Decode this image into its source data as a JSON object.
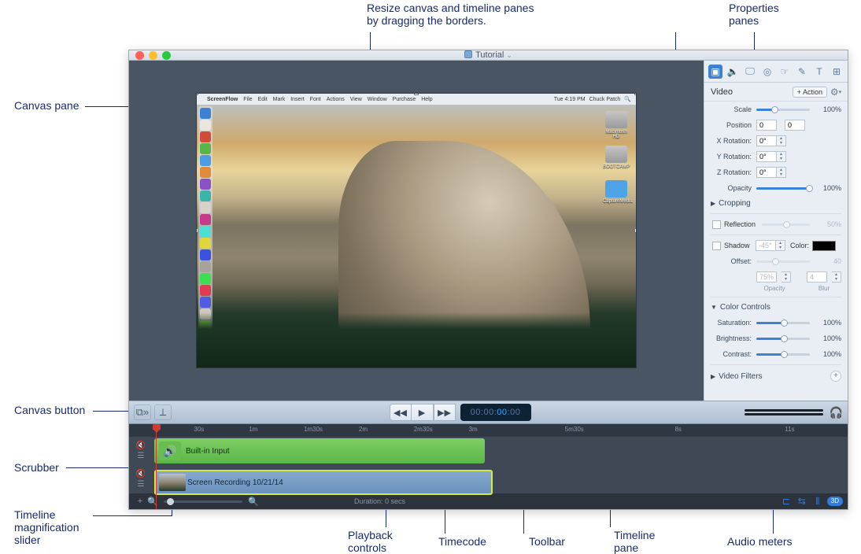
{
  "callouts": {
    "resize": "Resize canvas and timeline panes\nby dragging the borders.",
    "props": "Properties\npanes",
    "canvas_pane": "Canvas pane",
    "canvas_button": "Canvas button",
    "scrubber": "Scrubber",
    "mag": "Timeline\nmagnification\nslider",
    "playback": "Playback\ncontrols",
    "timecode": "Timecode",
    "toolbar": "Toolbar",
    "timeline_pane": "Timeline\npane",
    "audio_meters": "Audio meters"
  },
  "window": {
    "title": "Tutorial"
  },
  "canvas": {
    "menubar": {
      "app": "ScreenFlow",
      "items": [
        "File",
        "Edit",
        "Mark",
        "Insert",
        "Font",
        "Actions",
        "View",
        "Window",
        "Purchase",
        "Help"
      ],
      "clock": "Tue 4:19 PM",
      "user": "Chuck Patch"
    },
    "desktop_icons": [
      "Macintosh HD",
      "BOOTCAMP",
      "CaptureMedia"
    ]
  },
  "props": {
    "title": "Video",
    "action_btn": "+ Action",
    "scale": {
      "label": "Scale",
      "value": "100%",
      "pct": 100
    },
    "position": {
      "label": "Position",
      "x": "0",
      "y": "0"
    },
    "xrot": {
      "label": "X Rotation:",
      "value": "0°"
    },
    "yrot": {
      "label": "Y Rotation:",
      "value": "0°"
    },
    "zrot": {
      "label": "Z Rotation:",
      "value": "0°"
    },
    "opacity": {
      "label": "Opacity",
      "value": "100%",
      "pct": 100
    },
    "cropping": "Cropping",
    "reflection": {
      "label": "Reflection",
      "value": "50%"
    },
    "shadow": {
      "label": "Shadow",
      "angle": "-45°",
      "color_label": "Color:"
    },
    "offset": {
      "label": "Offset:",
      "value": "40"
    },
    "shadow_opacity": "75%",
    "shadow_blur": "4",
    "opacity_sub": "Opacity",
    "blur_sub": "Blur",
    "color_controls": "Color Controls",
    "saturation": {
      "label": "Saturation:",
      "value": "100%",
      "pct": 50
    },
    "brightness": {
      "label": "Brightness:",
      "value": "100%",
      "pct": 50
    },
    "contrast": {
      "label": "Contrast:",
      "value": "100%",
      "pct": 50
    },
    "video_filters": "Video Filters"
  },
  "toolbar": {
    "timecode_lead": "00:00:",
    "timecode_sec": "00",
    "timecode_fr": ":00"
  },
  "timeline": {
    "ruler": [
      "30s",
      "1m",
      "1m30s",
      "2m",
      "2m30s",
      "3m",
      "5m30s",
      "8s",
      "11s"
    ],
    "audio_clip": "Built-in Input",
    "video_clip": "Screen Recording 10/21/14"
  },
  "footer": {
    "duration": "Duration: 0 secs",
    "pill": "3D"
  }
}
